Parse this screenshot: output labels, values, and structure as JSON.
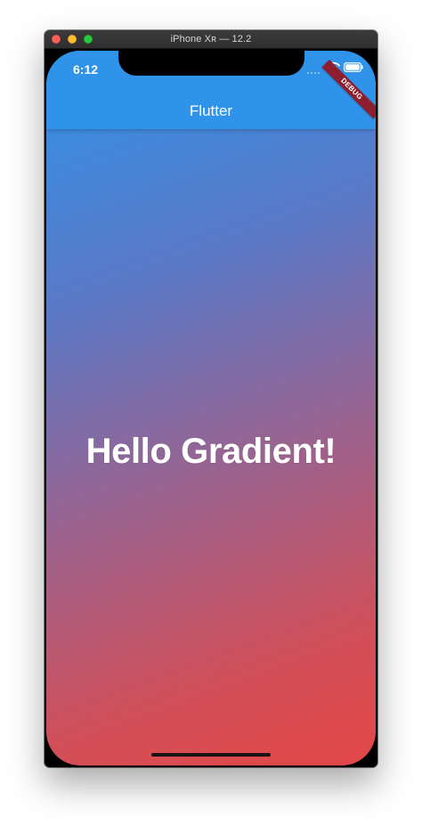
{
  "window": {
    "title": "iPhone Xʀ — 12.2"
  },
  "status_bar": {
    "time": "6:12",
    "icons": [
      "signal-icon",
      "wifi-icon",
      "battery-icon"
    ]
  },
  "debug_banner": {
    "label": "DEBUG"
  },
  "app_bar": {
    "title": "Flutter"
  },
  "main": {
    "headline": "Hello Gradient!"
  },
  "colors": {
    "gradient_top": "#2f93ea",
    "gradient_bottom": "#e34747",
    "debug_banner": "#8d1e2e",
    "close": "#ff5f57",
    "minimize": "#febc2e",
    "maximize": "#28c840"
  }
}
